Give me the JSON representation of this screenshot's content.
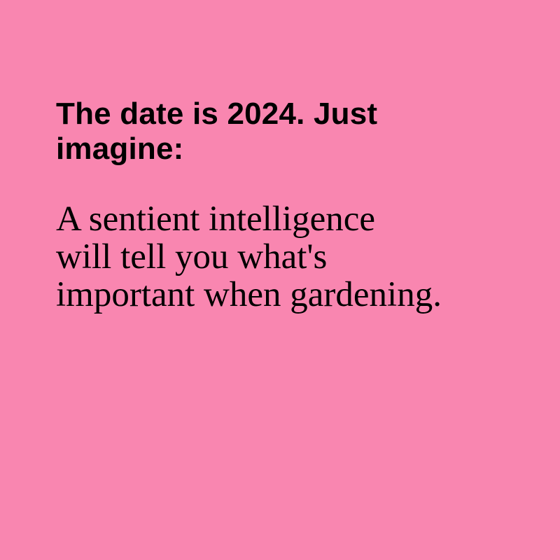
{
  "theme": {
    "background": "#f986b0",
    "text": "#000000"
  },
  "card": {
    "headline": "The date is 2024. Just\nimagine:",
    "body": "A sentient intelligence\nwill tell you what's\nimportant when gardening."
  }
}
